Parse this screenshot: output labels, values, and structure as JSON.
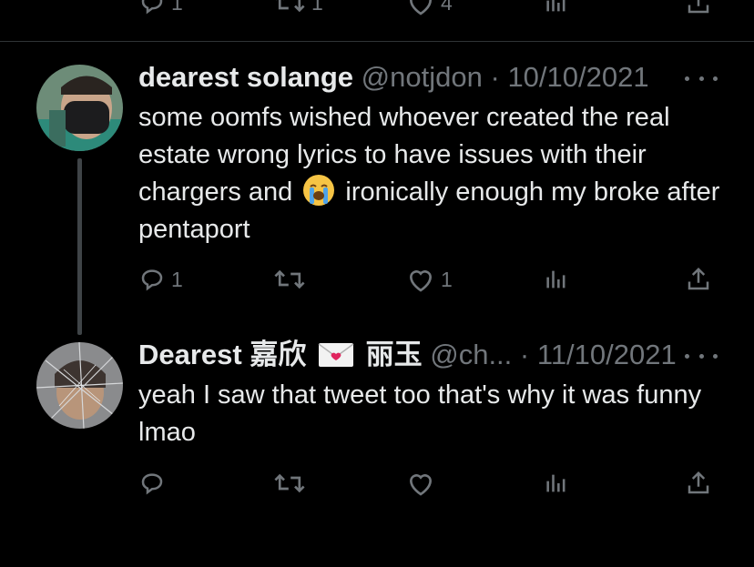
{
  "prev_tweet": {
    "reply_count": "1",
    "retweet_count": "1",
    "like_count": "4"
  },
  "tweets": [
    {
      "name": "dearest solange",
      "handle": "@notjdon",
      "separator": "·",
      "date": "10/10/2021",
      "text_part1": "some oomfs wished whoever created the real estate wrong lyrics to have issues with their chargers and",
      "emoji": "loudly-crying-face",
      "text_part2": "ironically enough my broke after pentaport",
      "reply_count": "1",
      "retweet_count": "",
      "like_count": "1"
    },
    {
      "name_part1": "Dearest 嘉欣",
      "emoji": "love-letter",
      "name_part2": "丽玉",
      "handle": "@ch...",
      "separator": "·",
      "date": "11/10/2021",
      "text": "yeah I saw that tweet too that's why it was funny lmao",
      "reply_count": "",
      "retweet_count": "",
      "like_count": ""
    }
  ],
  "colors": {
    "background": "#000000",
    "text": "#e7e9ea",
    "muted": "#71767b",
    "divider": "#2f3336"
  }
}
